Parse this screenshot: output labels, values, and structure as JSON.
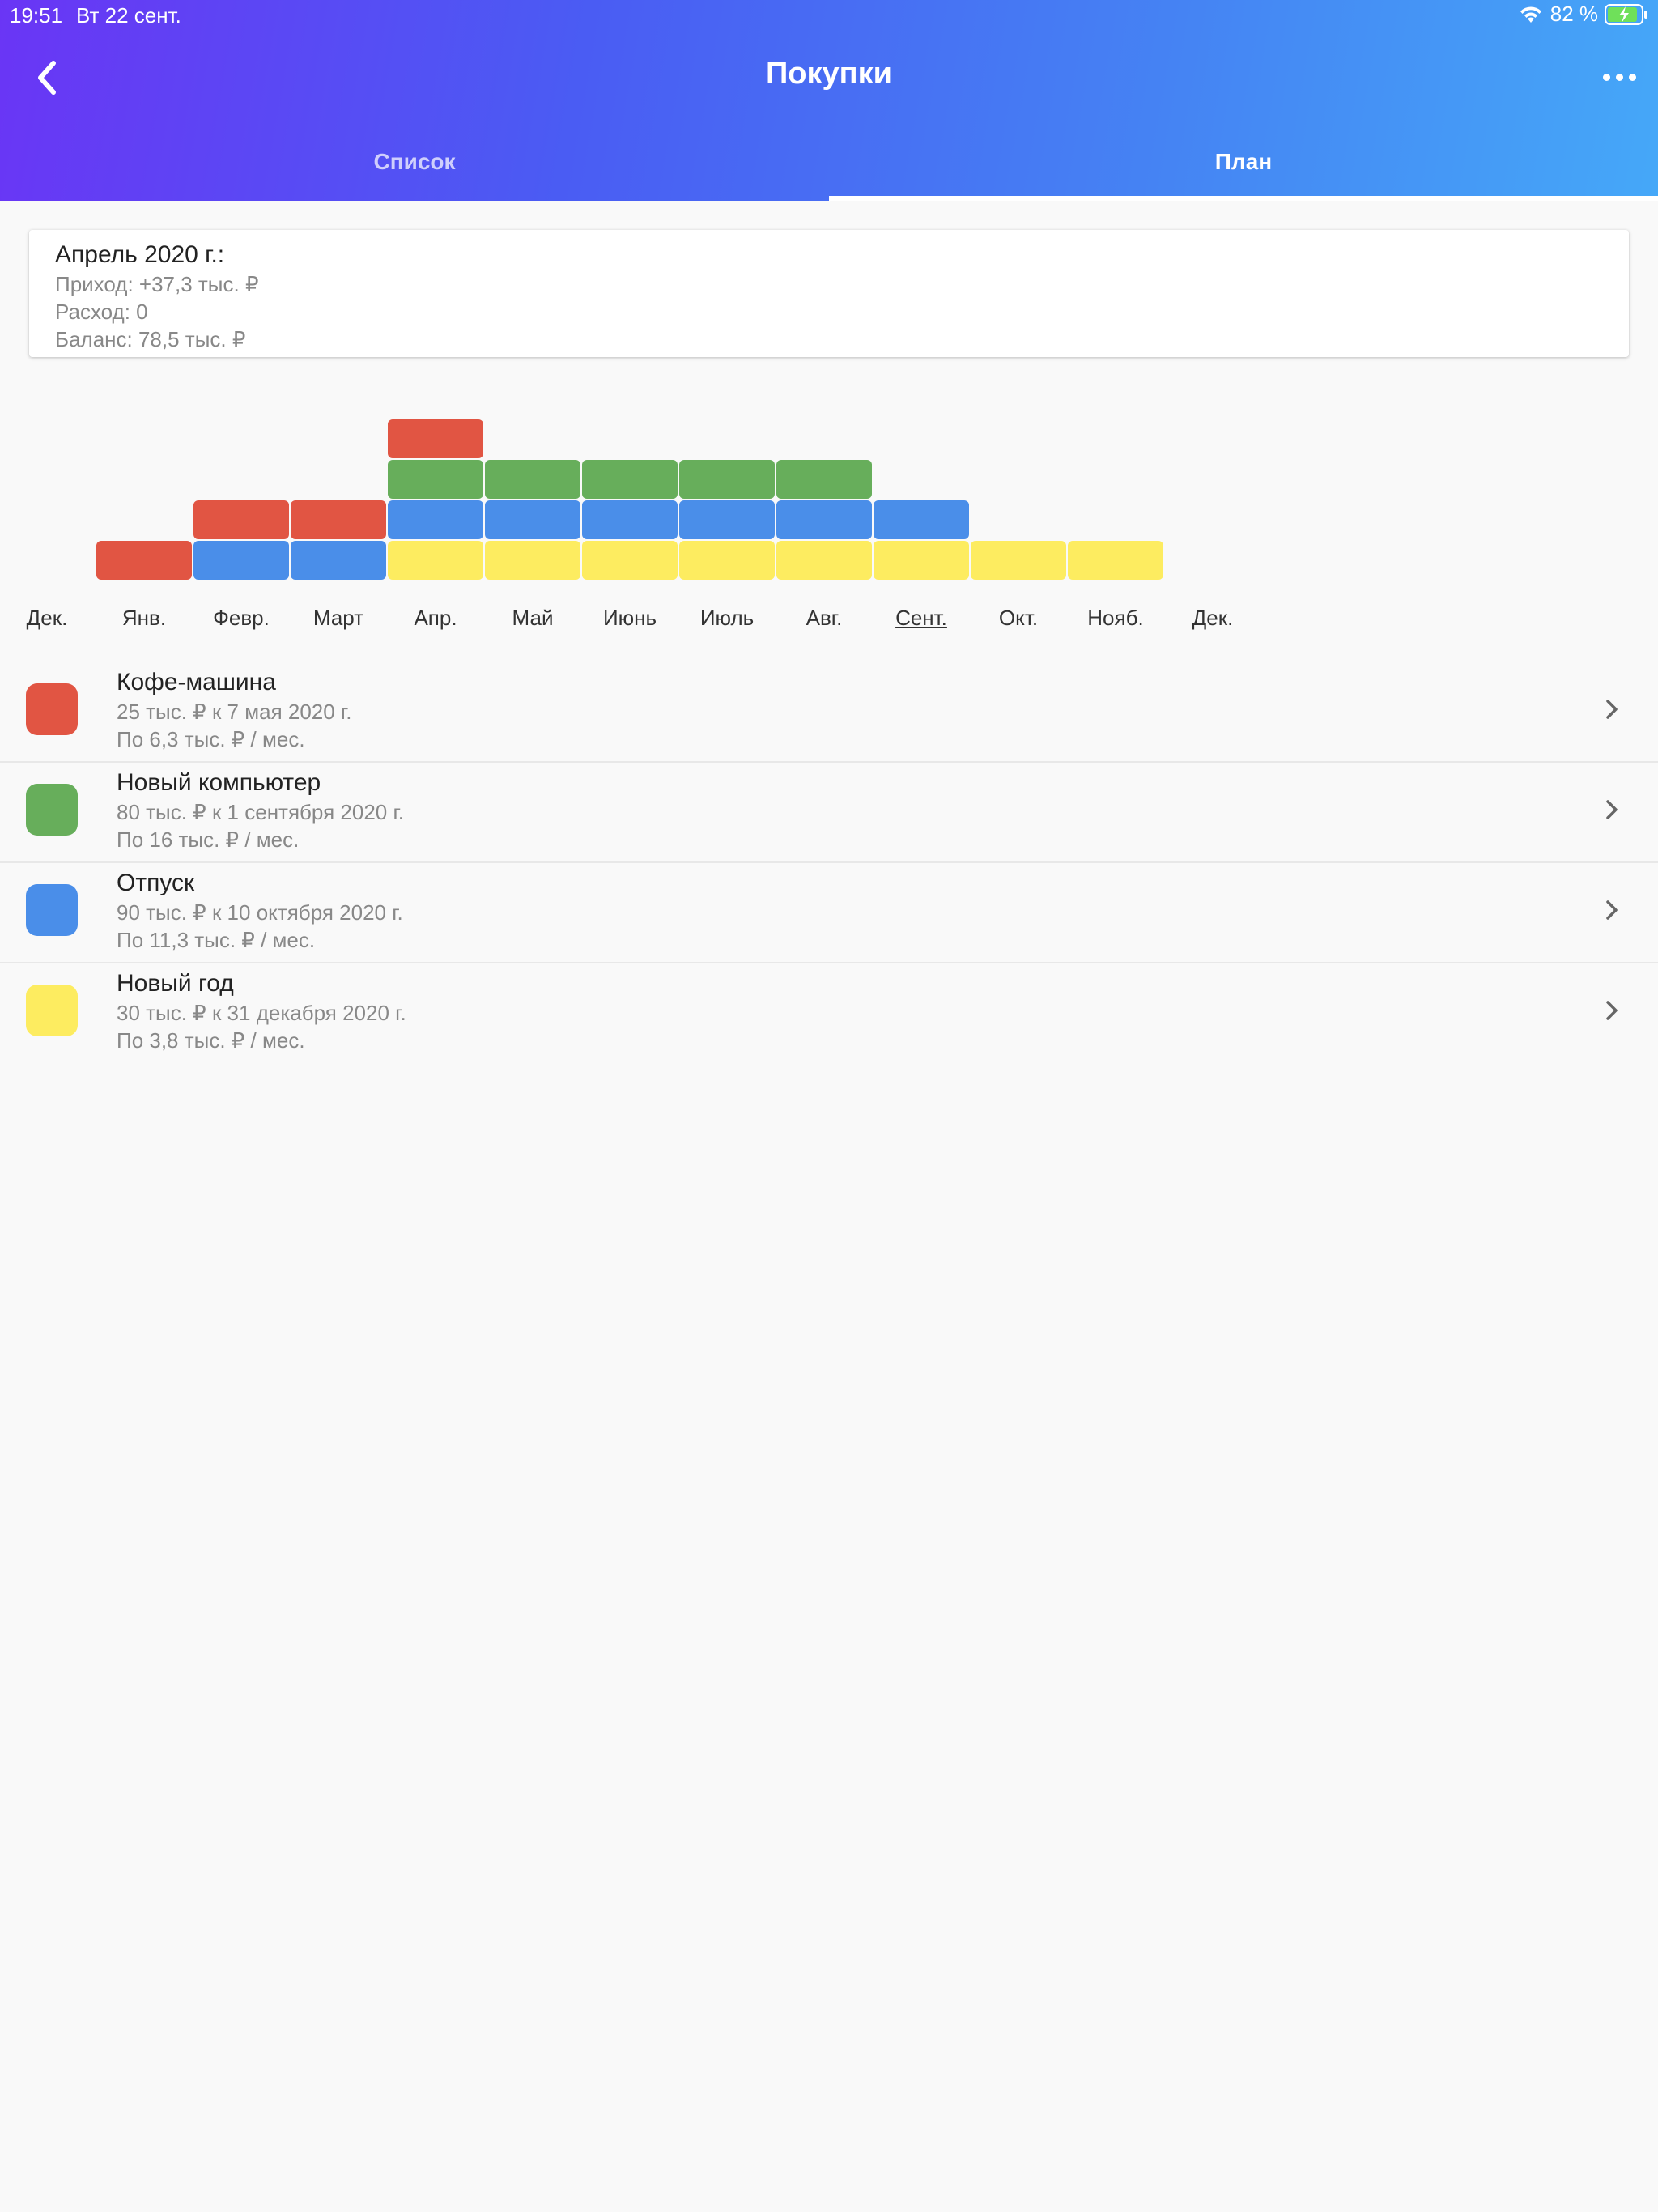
{
  "status": {
    "time": "19:51",
    "date": "Вт 22 сент.",
    "battery": "82 %"
  },
  "header": {
    "title": "Покупки",
    "back_icon": "chevron-left-icon",
    "more_icon": "ellipsis-icon"
  },
  "tabs": [
    {
      "label": "Список",
      "active": false
    },
    {
      "label": "План",
      "active": true
    }
  ],
  "summary": {
    "title": "Апрель 2020 г.:",
    "income": "Приход: +37,3 тыс. ₽",
    "expense": "Расход: 0",
    "balance": "Баланс: 78,5 тыс. ₽"
  },
  "chart_data": {
    "type": "bar",
    "stacked": true,
    "categories": [
      "Дек.",
      "Янв.",
      "Февр.",
      "Март",
      "Апр.",
      "Май",
      "Июнь",
      "Июль",
      "Авг.",
      "Сент.",
      "Окт.",
      "Нояб.",
      "Дек."
    ],
    "current_category": "Сент.",
    "series": [
      {
        "color": "#fdec60",
        "values": [
          0,
          0,
          0,
          0,
          1,
          1,
          1,
          1,
          1,
          1,
          1,
          1,
          0
        ]
      },
      {
        "color": "#4a8ee9",
        "values": [
          0,
          0,
          1,
          1,
          1,
          1,
          1,
          1,
          1,
          1,
          0,
          0,
          0
        ]
      },
      {
        "color": "#67ae5b",
        "values": [
          0,
          0,
          0,
          0,
          1,
          1,
          1,
          1,
          1,
          0,
          0,
          0,
          0
        ]
      },
      {
        "color": "#e15543",
        "values": [
          0,
          1,
          1,
          1,
          1,
          0,
          0,
          0,
          0,
          0,
          0,
          0,
          0
        ]
      }
    ]
  },
  "goals": [
    {
      "name": "Кофе-машина",
      "target": "25 тыс. ₽ к 7 мая 2020 г.",
      "rate": "По 6,3 тыс. ₽ / мес.",
      "color": "#e15543"
    },
    {
      "name": "Новый компьютер",
      "target": "80 тыс. ₽ к 1 сентября 2020 г.",
      "rate": "По 16 тыс. ₽ / мес.",
      "color": "#67ae5b"
    },
    {
      "name": "Отпуск",
      "target": "90 тыс. ₽ к 10 октября 2020 г.",
      "rate": "По 11,3 тыс. ₽ / мес.",
      "color": "#4a8ee9"
    },
    {
      "name": "Новый год",
      "target": "30 тыс. ₽ к 31 декабря 2020 г.",
      "rate": "По 3,8 тыс. ₽ / мес.",
      "color": "#fdec60"
    }
  ]
}
